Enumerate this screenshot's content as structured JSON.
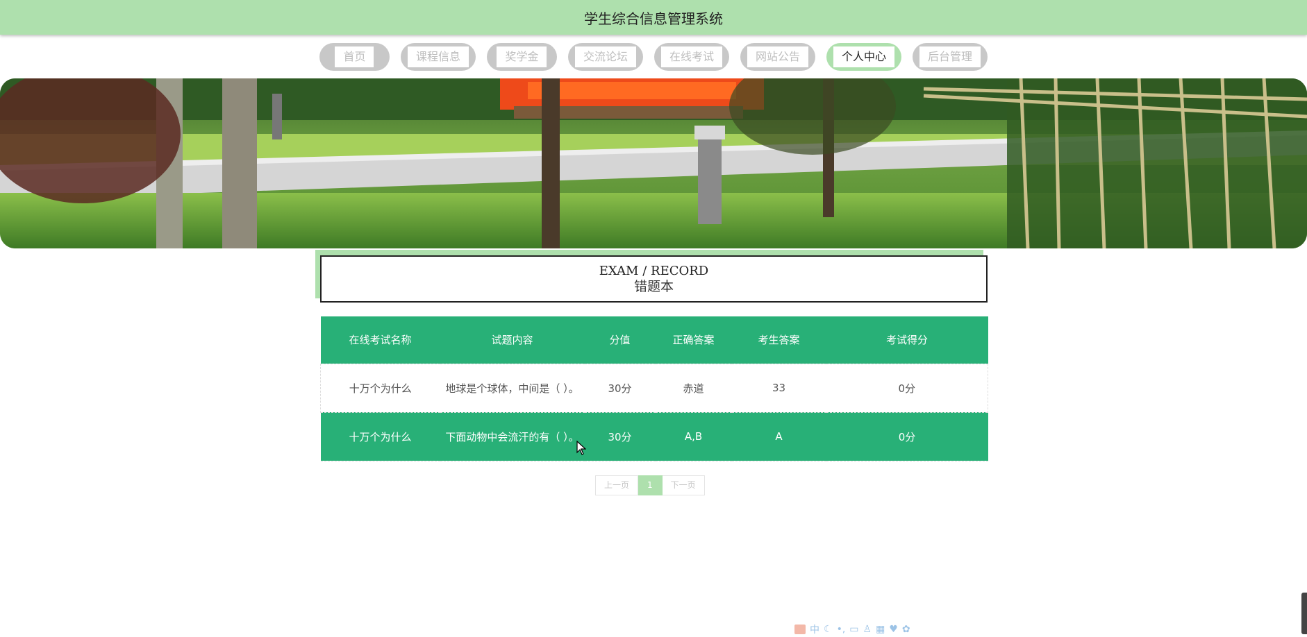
{
  "header": {
    "title": "学生综合信息管理系统"
  },
  "nav": {
    "items": [
      {
        "label": "首页",
        "active": false
      },
      {
        "label": "课程信息",
        "active": false
      },
      {
        "label": "奖学金",
        "active": false
      },
      {
        "label": "交流论坛",
        "active": false
      },
      {
        "label": "在线考试",
        "active": false
      },
      {
        "label": "网站公告",
        "active": false
      },
      {
        "label": "个人中心",
        "active": true
      },
      {
        "label": "后台管理",
        "active": false
      }
    ]
  },
  "section": {
    "title_en_left": "EXAM",
    "title_sep": " / ",
    "title_en_right": "RECORD",
    "title_cn": "错题本"
  },
  "table": {
    "headers": [
      "在线考试名称",
      "试题内容",
      "分值",
      "正确答案",
      "考生答案",
      "考试得分"
    ],
    "rows": [
      [
        "十万个为什么",
        "地球是个球体，中间是（ ）。",
        "30分",
        "赤道",
        "33",
        "0分"
      ],
      [
        "十万个为什么",
        "下面动物中会流汗的有（ ）。",
        "30分",
        "A,B",
        "A",
        "0分"
      ]
    ]
  },
  "pager": {
    "prev": "上一页",
    "current": "1",
    "next": "下一页"
  },
  "ime": {
    "mode": "中"
  },
  "colors": {
    "header_bg": "#aee0ad",
    "table_accent": "#28b077",
    "nav_inactive": "#c8c8c8"
  }
}
